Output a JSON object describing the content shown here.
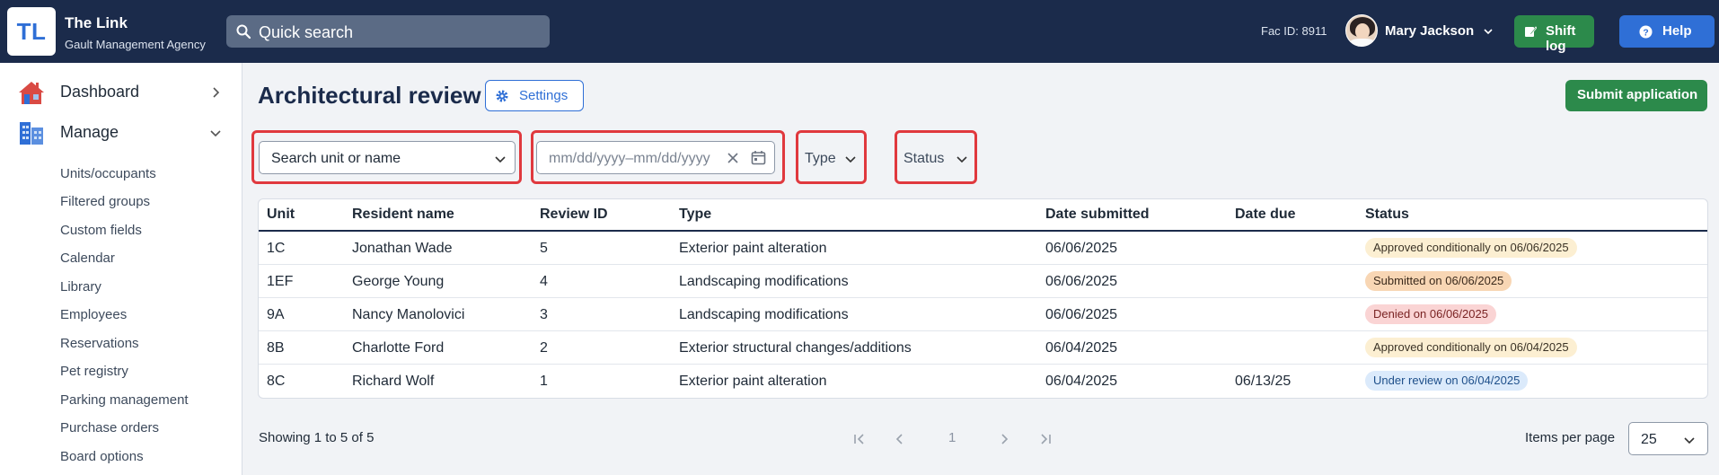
{
  "app": {
    "logo_text": "TL",
    "title": "The Link",
    "subtitle": "Gault Management Agency"
  },
  "topbar": {
    "search_label": "Quick search",
    "fac_id": "Fac ID: 8911",
    "user_name": "Mary Jackson",
    "shift_log_label": "Shift log",
    "help_label": "Help"
  },
  "sidebar": {
    "dashboard_label": "Dashboard",
    "manage_label": "Manage",
    "sub_items": [
      "Units/occupants",
      "Filtered groups",
      "Custom fields",
      "Calendar",
      "Library",
      "Employees",
      "Reservations",
      "Pet registry",
      "Parking management",
      "Purchase orders",
      "Board options"
    ]
  },
  "page": {
    "title": "Architectural review",
    "settings_label": "Settings",
    "submit_label": "Submit application"
  },
  "filters": {
    "unit_search": "Search unit or name",
    "date_range": "mm/dd/yyyy–mm/dd/yyyy",
    "type": "Type",
    "status": "Status"
  },
  "table": {
    "headers": [
      "Unit",
      "Resident name",
      "Review ID",
      "Type",
      "Date submitted",
      "Date due",
      "Status"
    ],
    "rows": [
      {
        "unit": "1C",
        "name": "Jonathan Wade",
        "id": "5",
        "type": "Exterior paint alteration",
        "submitted": "06/06/2025",
        "due": "",
        "status": "Approved conditionally on 06/06/2025",
        "status_kind": "approved-cond"
      },
      {
        "unit": "1EF",
        "name": "George Young",
        "id": "4",
        "type": "Landscaping modifications",
        "submitted": "06/06/2025",
        "due": "",
        "status": "Submitted on 06/06/2025",
        "status_kind": "submitted"
      },
      {
        "unit": "9A",
        "name": "Nancy Manolovici",
        "id": "3",
        "type": "Landscaping modifications",
        "submitted": "06/06/2025",
        "due": "",
        "status": "Denied on 06/06/2025",
        "status_kind": "denied"
      },
      {
        "unit": "8B",
        "name": "Charlotte Ford",
        "id": "2",
        "type": "Exterior structural changes/additions",
        "submitted": "06/04/2025",
        "due": "",
        "status": "Approved conditionally on 06/04/2025",
        "status_kind": "approved-cond"
      },
      {
        "unit": "8C",
        "name": "Richard Wolf",
        "id": "1",
        "type": "Exterior paint alteration",
        "submitted": "06/04/2025",
        "due": "06/13/25",
        "status": "Under review on 06/04/2025",
        "status_kind": "under-review"
      }
    ],
    "status_colors": {
      "approved-cond": {
        "bg": "#fcefd2",
        "fg": "#3b3326"
      },
      "submitted": {
        "bg": "#f8d6b4",
        "fg": "#3b2a1c"
      },
      "denied": {
        "bg": "#fad4d4",
        "fg": "#7a2424"
      },
      "under-review": {
        "bg": "#dbeafb",
        "fg": "#1e4f8a"
      }
    }
  },
  "pagination": {
    "showing": "Showing 1 to 5 of 5",
    "current_page": "1",
    "items_per_page_label": "Items per page",
    "items_per_page": "25"
  },
  "colors": {
    "topbar": "#1b2b4b",
    "primary": "#2f6fd6",
    "success": "#2c8a4b",
    "highlight": "#e0393e"
  }
}
